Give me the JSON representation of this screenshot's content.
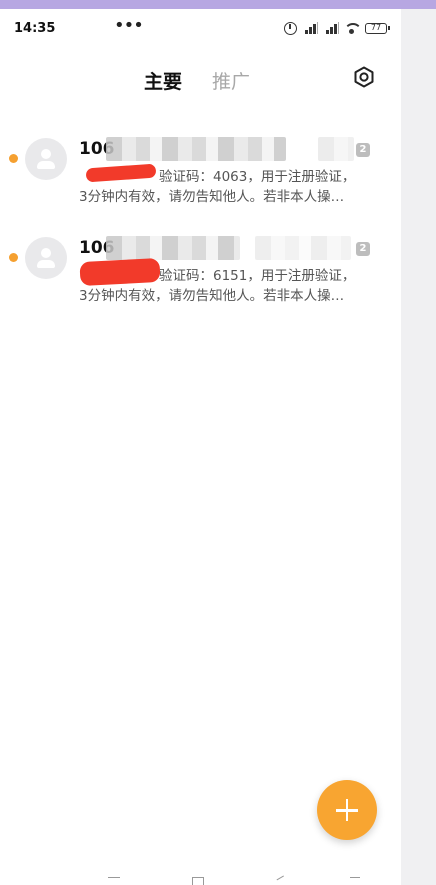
{
  "status_bar": {
    "time": "14:35",
    "more": "•••",
    "battery": "77",
    "icons": [
      "alarm-icon",
      "signal-icon",
      "signal-icon",
      "wifi-icon",
      "battery-icon"
    ]
  },
  "header": {
    "tabs": [
      {
        "label": "主要",
        "active": true
      },
      {
        "label": "推广",
        "active": false
      }
    ],
    "settings_icon": "settings-icon"
  },
  "messages": [
    {
      "sender": "106",
      "count": "2",
      "line1": "验证码：4063，用于注册验证，",
      "line2": "3分钟内有效，请勿告知他人。若非本人操…",
      "unread": true
    },
    {
      "sender": "106",
      "count": "2",
      "line1": "验证码：6151，用于注册验证，",
      "line2": "3分钟内有效，请勿告知他人。若非本人操…",
      "unread": true
    }
  ],
  "fab": {
    "icon": "plus-icon"
  },
  "colors": {
    "accent": "#f8a531",
    "unread_dot": "#f5a030",
    "top_strip": "#b7a7e2",
    "redaction": "#f23a2a"
  }
}
